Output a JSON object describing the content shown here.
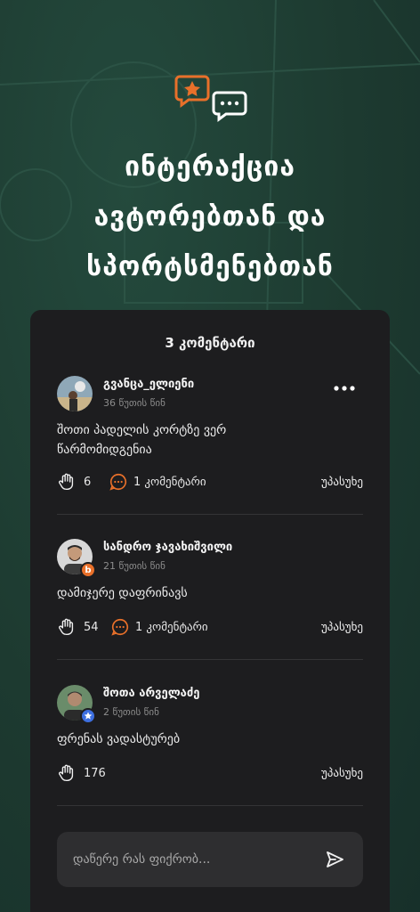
{
  "hero": {
    "title_line1": "ინტერაქცია",
    "title_line2": "ავტორებთან და",
    "title_line3": "სპორტსმენებთან",
    "icons": [
      "star-chat-icon",
      "dots-chat-icon"
    ],
    "accent": "#e8702a"
  },
  "comments_panel": {
    "header": "3 კომენტარი",
    "comments": [
      {
        "author": "გვანცა_ელიენი",
        "time": "36 წუთის წინ",
        "text": "შოთი პადელის კორტზე ვერ წარმომიდგენია",
        "likes": "6",
        "replies": "1 კომენტარი",
        "reply_label": "უპასუხე",
        "has_more_menu": true
      },
      {
        "author": "სანდრო ჯავახიშვილი",
        "time": "21 წუთის წინ",
        "text": "დამიჯერე დაფრინავს",
        "likes": "54",
        "replies": "1 კომენტარი",
        "reply_label": "უპასუხე",
        "badge": "b",
        "badge_color": "#e8702a"
      },
      {
        "author": "შოთა არველაძე",
        "time": "2 წუთის წინ",
        "text": "ფრენას ვადასტურებ",
        "likes": "176",
        "reply_label": "უპასუხე",
        "badge": "star",
        "badge_color": "#3d6fe0"
      }
    ],
    "input": {
      "placeholder": "დაწერე რას ფიქრობ..."
    }
  }
}
